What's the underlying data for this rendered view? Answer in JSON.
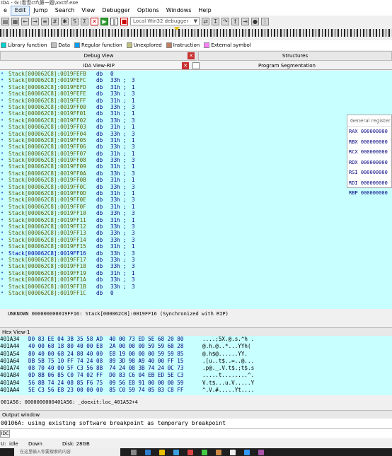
{
  "window": {
    "title": "IDA - G:\\看雪ctf\\第一题\\xxctf.exe"
  },
  "menu": [
    "e",
    "Edit",
    "Jump",
    "Search",
    "View",
    "Debugger",
    "Options",
    "Windows",
    "Help"
  ],
  "toolbar": {
    "debugger_select": "Local Win32 debugger"
  },
  "legend": [
    {
      "label": "Library function",
      "color": "#00d0d0"
    },
    {
      "label": "Data",
      "color": "#c0c0c0"
    },
    {
      "label": "Regular function",
      "color": "#00a0ff"
    },
    {
      "label": "Unexplored",
      "color": "#c0c080"
    },
    {
      "label": "Instruction",
      "color": "#c08060"
    },
    {
      "label": "External symbol",
      "color": "#ff80ff"
    }
  ],
  "panels": {
    "debug_view": "Debug View",
    "structures": "Structures",
    "ida_view": "IDA View-RIP",
    "segmentation": "Program Segmentation"
  },
  "code_lines": [
    {
      "addr": "Stack[000062C8]:0019FEFB",
      "mnem": "db",
      "val": "0",
      "cmt": "",
      "cmt2": ""
    },
    {
      "addr": "Stack[000062C8]:0019FEFC",
      "mnem": "db",
      "val": "33h",
      "cmt": ";",
      "cmt2": "3"
    },
    {
      "addr": "Stack[000062C8]:0019FEFD",
      "mnem": "db",
      "val": "31h",
      "cmt": ";",
      "cmt2": "1"
    },
    {
      "addr": "Stack[000062C8]:0019FEFE",
      "mnem": "db",
      "val": "33h",
      "cmt": ";",
      "cmt2": "3"
    },
    {
      "addr": "Stack[000062C8]:0019FEFF",
      "mnem": "db",
      "val": "31h",
      "cmt": ";",
      "cmt2": "1"
    },
    {
      "addr": "Stack[000062C8]:0019FF00",
      "mnem": "db",
      "val": "33h",
      "cmt": ";",
      "cmt2": "3"
    },
    {
      "addr": "Stack[000062C8]:0019FF01",
      "mnem": "db",
      "val": "31h",
      "cmt": ";",
      "cmt2": "1"
    },
    {
      "addr": "Stack[000062C8]:0019FF02",
      "mnem": "db",
      "val": "33h",
      "cmt": ";",
      "cmt2": "3"
    },
    {
      "addr": "Stack[000062C8]:0019FF03",
      "mnem": "db",
      "val": "31h",
      "cmt": ";",
      "cmt2": "1"
    },
    {
      "addr": "Stack[000062C8]:0019FF04",
      "mnem": "db",
      "val": "33h",
      "cmt": ";",
      "cmt2": "3"
    },
    {
      "addr": "Stack[000062C8]:0019FF05",
      "mnem": "db",
      "val": "31h",
      "cmt": ";",
      "cmt2": "1"
    },
    {
      "addr": "Stack[000062C8]:0019FF06",
      "mnem": "db",
      "val": "33h",
      "cmt": ";",
      "cmt2": "3"
    },
    {
      "addr": "Stack[000062C8]:0019FF07",
      "mnem": "db",
      "val": "31h",
      "cmt": ";",
      "cmt2": "1"
    },
    {
      "addr": "Stack[000062C8]:0019FF08",
      "mnem": "db",
      "val": "33h",
      "cmt": ";",
      "cmt2": "3"
    },
    {
      "addr": "Stack[000062C8]:0019FF09",
      "mnem": "db",
      "val": "31h",
      "cmt": ";",
      "cmt2": "1"
    },
    {
      "addr": "Stack[000062C8]:0019FF0A",
      "mnem": "db",
      "val": "33h",
      "cmt": ";",
      "cmt2": "3"
    },
    {
      "addr": "Stack[000062C8]:0019FF0B",
      "mnem": "db",
      "val": "31h",
      "cmt": ";",
      "cmt2": "1"
    },
    {
      "addr": "Stack[000062C8]:0019FF0C",
      "mnem": "db",
      "val": "33h",
      "cmt": ";",
      "cmt2": "3"
    },
    {
      "addr": "Stack[000062C8]:0019FF0D",
      "mnem": "db",
      "val": "31h",
      "cmt": ";",
      "cmt2": "1"
    },
    {
      "addr": "Stack[000062C8]:0019FF0E",
      "mnem": "db",
      "val": "33h",
      "cmt": ";",
      "cmt2": "3"
    },
    {
      "addr": "Stack[000062C8]:0019FF0F",
      "mnem": "db",
      "val": "31h",
      "cmt": ";",
      "cmt2": "1"
    },
    {
      "addr": "Stack[000062C8]:0019FF10",
      "mnem": "db",
      "val": "33h",
      "cmt": ";",
      "cmt2": "3"
    },
    {
      "addr": "Stack[000062C8]:0019FF11",
      "mnem": "db",
      "val": "31h",
      "cmt": ";",
      "cmt2": "1"
    },
    {
      "addr": "Stack[000062C8]:0019FF12",
      "mnem": "db",
      "val": "33h",
      "cmt": ";",
      "cmt2": "3"
    },
    {
      "addr": "Stack[000062C8]:0019FF13",
      "mnem": "db",
      "val": "33h",
      "cmt": ";",
      "cmt2": "3"
    },
    {
      "addr": "Stack[000062C8]:0019FF14",
      "mnem": "db",
      "val": "33h",
      "cmt": ";",
      "cmt2": "3"
    },
    {
      "addr": "Stack[000062C8]:0019FF15",
      "mnem": "db",
      "val": "31h",
      "cmt": ";",
      "cmt2": "1"
    },
    {
      "addr": "Stack[000062C8]:0019FF16",
      "mnem": "db",
      "val": "33h",
      "cmt": ";",
      "cmt2": "3"
    },
    {
      "addr": "Stack[000062C8]:0019FF17",
      "mnem": "db",
      "val": "33h",
      "cmt": ";",
      "cmt2": "3"
    },
    {
      "addr": "Stack[000062C8]:0019FF18",
      "mnem": "db",
      "val": "33h",
      "cmt": ";",
      "cmt2": "3"
    },
    {
      "addr": "Stack[000062C8]:0019FF19",
      "mnem": "db",
      "val": "31h",
      "cmt": ";",
      "cmt2": "1"
    },
    {
      "addr": "Stack[000062C8]:0019FF1A",
      "mnem": "db",
      "val": "33h",
      "cmt": ";",
      "cmt2": "3"
    },
    {
      "addr": "Stack[000062C8]:0019FF1B",
      "mnem": "db",
      "val": "33h",
      "cmt": ";",
      "cmt2": "3"
    },
    {
      "addr": "Stack[000062C8]:0019FF1C",
      "mnem": "db",
      "val": "0",
      "cmt": "",
      "cmt2": ""
    }
  ],
  "code_status": "UNKNOWN 000000000019FF16: Stack[000062C8]:0019FF16 (Synchronized with RIP)",
  "registers": {
    "title": "General register",
    "rows": [
      "RAX 000000000",
      "RBX 000000000",
      "RCX 000000000",
      "RDX 000000000",
      "RSI 000000000",
      "RDI 000000000",
      "RBP 000000000"
    ]
  },
  "hex_view": {
    "title": "Hex View-1",
    "rows": [
      {
        "addr": "401A34",
        "bytes": "D0 83 EE 04 3B 35 58 AD  40 00 73 ED 5E 68 20 80",
        "ascii": "....;5X.@.s.^h ."
      },
      {
        "addr": "401A44",
        "bytes": "40 00 68 18 80 40 00 E8  2A 00 00 00 59 59 68 28",
        "ascii": "@.h.@..*...YYh("
      },
      {
        "addr": "401A54",
        "bytes": "80 40 00 68 24 80 40 00  E8 19 00 00 00 59 59 85",
        "ascii": "@.h$@......YY."
      },
      {
        "addr": "401A64",
        "bytes": "DB 5B 75 10 FF 74 24 08  89 3D 98 A9 40 00 FF 15",
        "ascii": ".[u..t$..=..@..."
      },
      {
        "addr": "401A74",
        "bytes": "08 70 40 00 5F C3 56 8B  74 24 08 3B 74 24 0C 73",
        "ascii": ".p@._.V.t$.;t$.s"
      },
      {
        "addr": "401A84",
        "bytes": "0D 8B 06 85 C0 74 02 FF  D0 83 C6 04 EB ED 5E C3",
        "ascii": ".....t........^."
      },
      {
        "addr": "401A94",
        "bytes": "56 8B 74 24 08 85 F6 75  09 56 E8 91 00 00 00 59",
        "ascii": "V.t$...u.V.....Y"
      },
      {
        "addr": "401AA4",
        "bytes": "5E C3 56 E8 23 00 00 00  85 C0 59 74 05 83 C8 FF",
        "ascii": "^.V.#.....Yt...."
      }
    ],
    "status": "001A56: 0000000000401A56: _doexit:loc_401A52+4"
  },
  "output": {
    "title": "Output window",
    "line": "00106A: using existing software breakpoint as temporary breakpoint",
    "idc_label": "IDC"
  },
  "statusbar": {
    "state": "idle",
    "direction": "Down",
    "disk": "Disk: 28GB",
    "prefix": "U:"
  },
  "taskbar": {
    "search_placeholder": "在这里输入你要搜索的内容"
  }
}
